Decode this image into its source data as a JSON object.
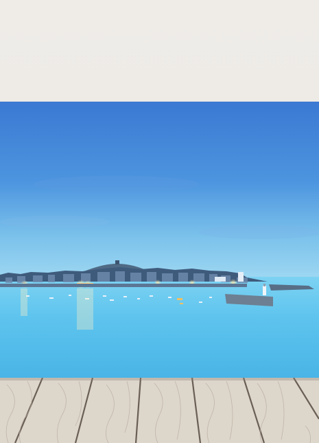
{
  "scene": {
    "subject": "harbour-town-at-dusk",
    "colors": {
      "wall": "#eeebe7",
      "sky_top": "#3f7fd6",
      "sky_horizon": "#8fd0ee",
      "sea": "#5cc3ec",
      "town_dark": "#3e5878",
      "lights": "#ffcf7a",
      "floor_wood": "#ded7cc",
      "floor_gap": "#6f655a"
    }
  }
}
